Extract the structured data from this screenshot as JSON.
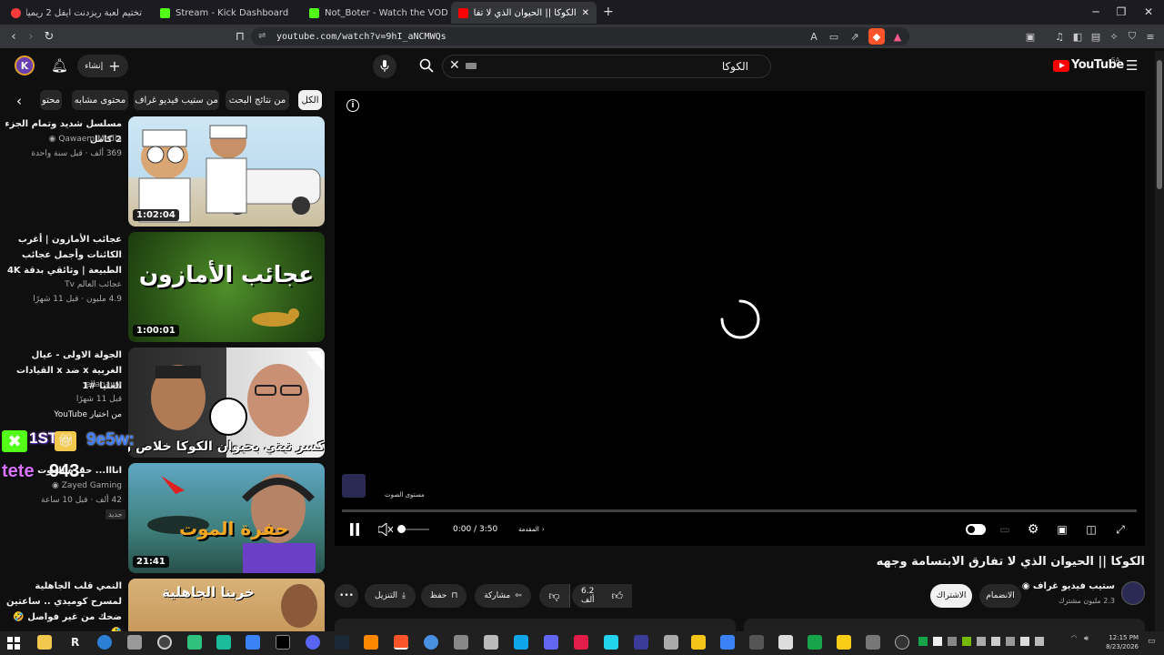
{
  "browser": {
    "tabs": [
      {
        "label": "تختيم لعبة ريزدنت ايفل 2 ريميك! 🔥😅 Ra",
        "color": "#ff3b3b"
      },
      {
        "label": "Stream - Kick Dashboard",
        "color": "#53fc18"
      },
      {
        "label": "Not_Boter - Watch the VOD on Kick",
        "color": "#53fc18"
      },
      {
        "label": "الكوكا || الحيوان الذي لا تفارق الابت...",
        "color": "#ff0000"
      }
    ],
    "url": "youtube.com/watch?v=9hI_aNCMWQs",
    "close_tab": "✕",
    "new_tab": "+"
  },
  "header": {
    "create_label": "إنشاء",
    "search_value": "الكوكا",
    "logo_text": "YouTube",
    "country": "SA"
  },
  "chips": [
    "الكل",
    "من نتائج البحث",
    "من ستيب فيديو غراف",
    "محتوى مشابه",
    "محتو"
  ],
  "recommendations": [
    {
      "title": "مسلسل شديد وتمام الجزء 2 كامل",
      "channel": "Qawaem Media",
      "meta": "369 ألف · قبل سنة واحدة",
      "duration": "1:02:04"
    },
    {
      "title": "عجائب الأمازون | أغرب الكائنات وأجمل عجائب الطبيعة | وثائقي بدقة 4K",
      "channel": "عجائب العالم Tv",
      "meta": "4.9 مليون · قبل 11 شهرًا",
      "duration": "1:00:01",
      "thumb_text": "عجائب الأمازون"
    },
    {
      "title": "الجولة الاولى - عيال الغربية x ضد x القيادات العليا #1",
      "channel": "ellanawy",
      "meta": "قبل 11 شهرًا",
      "extra": "من اختيار YouTube",
      "thumb_text": "كسر تيتي بحيوان الكوكا خلاص رده"
    },
    {
      "title": "انااا... حفرة الموت",
      "channel": "Zayed Gaming",
      "meta": "42 ألف · قبل 10 ساعة",
      "badge": "جديد",
      "duration": "21:41",
      "thumb_text": "حفرة الموت"
    },
    {
      "title": "النمي قلب الجاهلية لمسرح كوميدي .. ساعتين ضحك من غير فواصل 🤣🤣",
      "channel": "",
      "meta": "",
      "thumb_text": "خربنا الجاهلية"
    }
  ],
  "overlay": {
    "tag1": "9e5w:",
    "tag2": "tete",
    "tag3": "943:",
    "badge": "1ST"
  },
  "player": {
    "time": "0:00 / 3:50",
    "chapter": "المقدمة",
    "volume_tooltip": "مستوى الصوت"
  },
  "video": {
    "title": "الكوكا || الحيوان الذي لا تفارق الابتسامة وجهه",
    "channel": "ستيب فيديو غراف",
    "subscribers": "2.3 مليون مشترك",
    "join_label": "الانضمام",
    "subscribe_label": "الاشتراك",
    "likes": "6.2 ألف",
    "share_label": "مشاركة",
    "save_label": "حفظ",
    "download_label": "التنزيل"
  },
  "taskbar": {
    "time": "12:15 PM",
    "date": "8/23/2026"
  }
}
